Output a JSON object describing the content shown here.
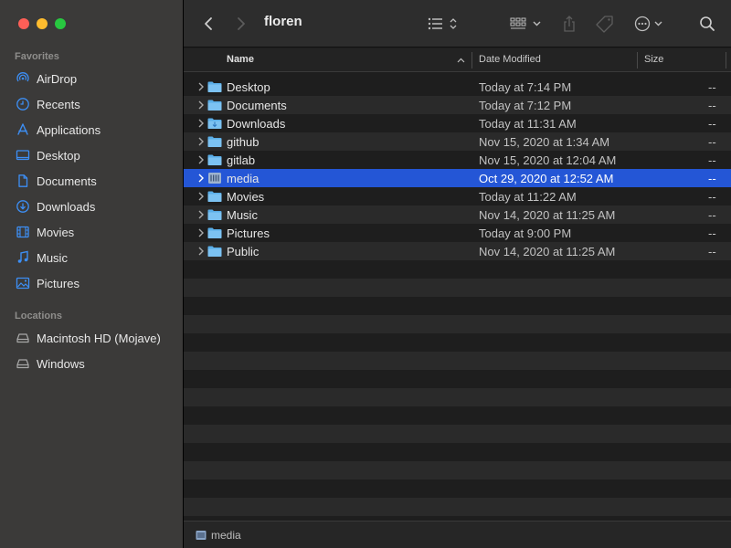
{
  "window": {
    "title": "floren"
  },
  "sidebar": {
    "favorites_label": "Favorites",
    "favorites": [
      {
        "label": "AirDrop",
        "icon": "airdrop-icon"
      },
      {
        "label": "Recents",
        "icon": "clock-icon"
      },
      {
        "label": "Applications",
        "icon": "applications-icon"
      },
      {
        "label": "Desktop",
        "icon": "desktop-icon"
      },
      {
        "label": "Documents",
        "icon": "document-icon"
      },
      {
        "label": "Downloads",
        "icon": "download-icon"
      },
      {
        "label": "Movies",
        "icon": "film-icon"
      },
      {
        "label": "Music",
        "icon": "music-note-icon"
      },
      {
        "label": "Pictures",
        "icon": "photo-icon"
      }
    ],
    "locations_label": "Locations",
    "locations": [
      {
        "label": "Macintosh HD (Mojave)",
        "icon": "disk-icon"
      },
      {
        "label": "Windows",
        "icon": "disk-icon"
      }
    ]
  },
  "columns": {
    "name": "Name",
    "date": "Date Modified",
    "size": "Size"
  },
  "files": [
    {
      "name": "Desktop",
      "date": "Today at 7:14 PM",
      "size": "--",
      "icon": "folder-icon",
      "selected": false
    },
    {
      "name": "Documents",
      "date": "Today at 7:12 PM",
      "size": "--",
      "icon": "folder-icon",
      "selected": false
    },
    {
      "name": "Downloads",
      "date": "Today at 11:31 AM",
      "size": "--",
      "icon": "folder-download-icon",
      "selected": false
    },
    {
      "name": "github",
      "date": "Nov 15, 2020 at 1:34 AM",
      "size": "--",
      "icon": "folder-icon",
      "selected": false
    },
    {
      "name": "gitlab",
      "date": "Nov 15, 2020 at 12:04 AM",
      "size": "--",
      "icon": "folder-icon",
      "selected": false
    },
    {
      "name": "media",
      "date": "Oct 29, 2020 at 12:52 AM",
      "size": "--",
      "icon": "media-folder-icon",
      "selected": true
    },
    {
      "name": "Movies",
      "date": "Today at 11:22 AM",
      "size": "--",
      "icon": "folder-icon",
      "selected": false
    },
    {
      "name": "Music",
      "date": "Nov 14, 2020 at 11:25 AM",
      "size": "--",
      "icon": "folder-icon",
      "selected": false
    },
    {
      "name": "Pictures",
      "date": "Today at 9:00 PM",
      "size": "--",
      "icon": "folder-icon",
      "selected": false
    },
    {
      "name": "Public",
      "date": "Nov 14, 2020 at 11:25 AM",
      "size": "--",
      "icon": "folder-icon",
      "selected": false
    }
  ],
  "pathbar": {
    "label": "media"
  },
  "colors": {
    "selection": "#2456d6",
    "folder": "#5aaee8",
    "sidebar_icon": "#3d8ff5"
  }
}
